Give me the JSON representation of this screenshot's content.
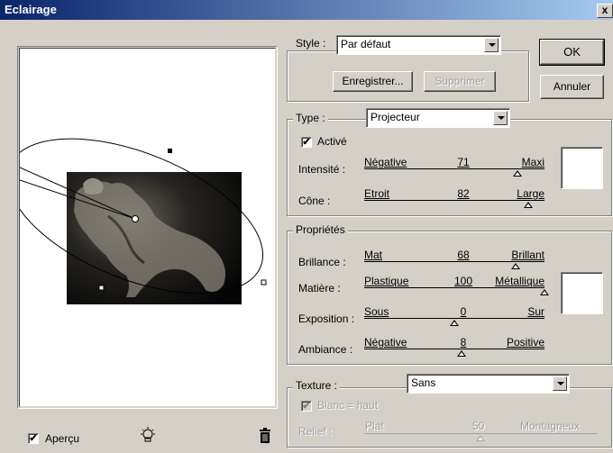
{
  "window": {
    "title": "Eclairage",
    "close_label": "x"
  },
  "preview": {
    "checkbox_label": "Aperçu",
    "checked": true,
    "check_mark": "✔"
  },
  "style": {
    "label": "Style :",
    "value": "Par défaut",
    "save_button": "Enregistrer...",
    "delete_button": "Supprimer"
  },
  "buttons": {
    "ok": "OK",
    "cancel": "Annuler"
  },
  "type": {
    "label": "Type :",
    "value": "Projecteur",
    "active_label": "Activé",
    "active_checked": true
  },
  "sliders_type": [
    {
      "label": "Intensité :",
      "left": "Négative",
      "value": "71",
      "right": "Maxi",
      "fraction": 0.85
    },
    {
      "label": "Cône :",
      "left": "Etroit",
      "value": "82",
      "right": "Large",
      "fraction": 0.91
    }
  ],
  "properties": {
    "legend": "Propriétés",
    "sliders": [
      {
        "label": "Brillance :",
        "left": "Mat",
        "value": "68",
        "right": "Brillant",
        "fraction": 0.84
      },
      {
        "label": "Matière :",
        "left": "Plastique",
        "value": "100",
        "right": "Métallique",
        "fraction": 1.0
      },
      {
        "label": "Exposition :",
        "left": "Sous",
        "value": "0",
        "right": "Sur",
        "fraction": 0.5
      },
      {
        "label": "Ambiance :",
        "left": "Négative",
        "value": "8",
        "right": "Positive",
        "fraction": 0.54
      }
    ]
  },
  "texture": {
    "label": "Texture :",
    "value": "Sans",
    "white_high_label": "Blanc = haut",
    "relief_label": "Relief :",
    "relief_left": "Plat",
    "relief_value": "50",
    "relief_right": "Montagneux",
    "relief_fraction": 0.5
  },
  "colors": {
    "title_start": "#0a246a",
    "title_end": "#a6caf0",
    "face": "#d4d0c8"
  }
}
